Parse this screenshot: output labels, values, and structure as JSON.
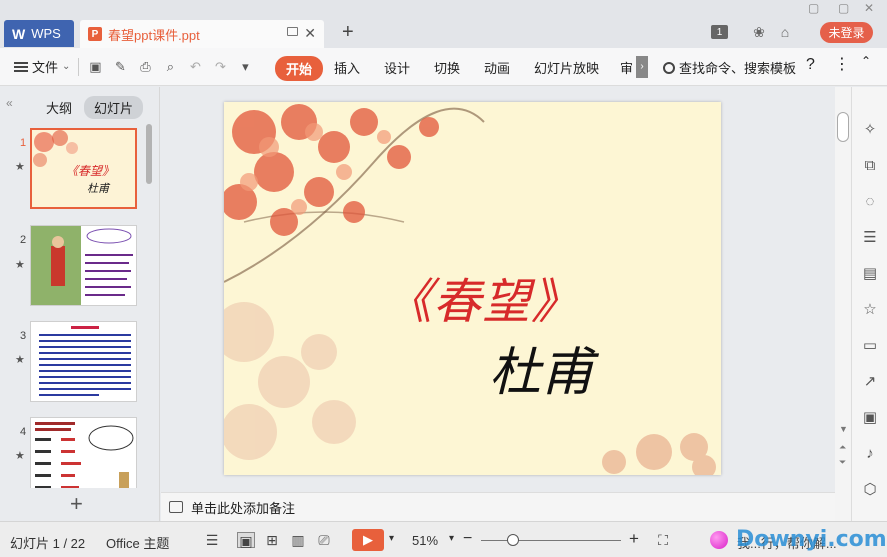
{
  "app": {
    "brand": "WPS",
    "doc_title": "春望ppt课件.ppt",
    "page_badge": "1",
    "login": "未登录"
  },
  "toolbar": {
    "file": "文件",
    "tabs": [
      "开始",
      "插入",
      "设计",
      "切换",
      "动画",
      "幻灯片放映",
      "审"
    ],
    "search": "查找命令、搜索模板",
    "help": "?"
  },
  "panel": {
    "outline_tab": "大纲",
    "slides_tab": "幻灯片",
    "slide_numbers": [
      "1",
      "2",
      "3",
      "4"
    ],
    "thumb1_title": "《春望》",
    "thumb1_author": "杜甫"
  },
  "slide": {
    "title": "《春望》",
    "author": "杜甫"
  },
  "notes": {
    "placeholder": "单击此处添加备注"
  },
  "status": {
    "slide_counter": "幻灯片 1 / 22",
    "theme": "Office 主题",
    "zoom": "51%",
    "watermark": "Downyi.com",
    "partial_text": "我...行，帮你解..."
  },
  "colors": {
    "accent": "#e8603c",
    "wps_blue": "#3f64b0",
    "title_red": "#d72a2a"
  }
}
